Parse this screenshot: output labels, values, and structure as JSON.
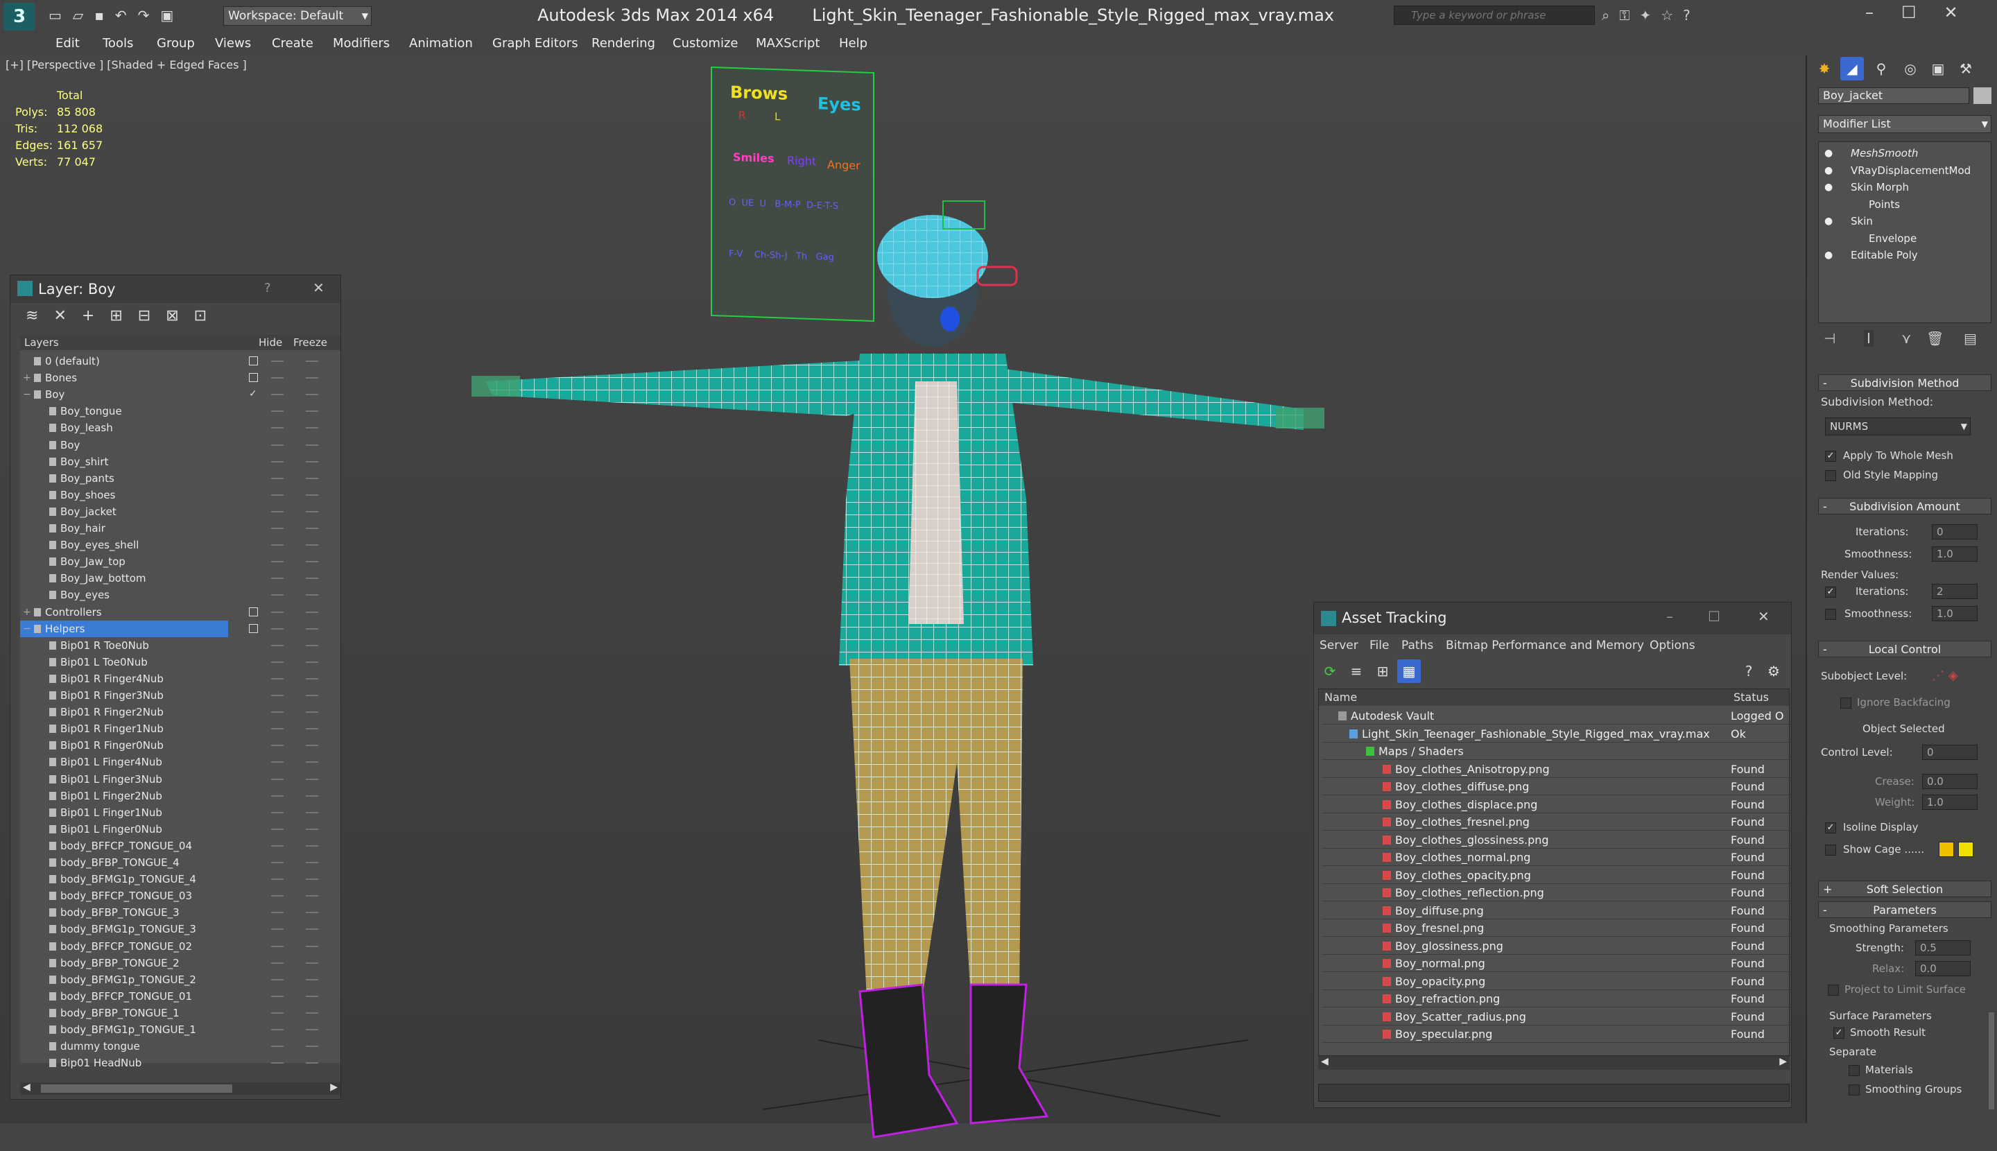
{
  "app": {
    "title": "Autodesk 3ds Max  2014 x64",
    "file": "Light_Skin_Teenager_Fashionable_Style_Rigged_max_vray.max",
    "workspace": "Workspace: Default",
    "search_placeholder": "Type a keyword or phrase"
  },
  "menu": [
    "Edit",
    "Tools",
    "Group",
    "Views",
    "Create",
    "Modifiers",
    "Animation",
    "Graph Editors",
    "Rendering",
    "Customize",
    "MAXScript",
    "Help"
  ],
  "viewport": {
    "label": "[+] [Perspective ] [Shaded + Edged Faces ]",
    "stats": {
      "total_label": "Total",
      "rows": [
        {
          "label": "Polys:",
          "value": "85 808"
        },
        {
          "label": "Tris:",
          "value": "112 068"
        },
        {
          "label": "Edges:",
          "value": "161 657"
        },
        {
          "label": "Verts:",
          "value": "77 047"
        }
      ]
    },
    "face_rig": {
      "brows": "Brows",
      "eyes": "Eyes",
      "r": "R",
      "l": "L",
      "smiles": "Smiles",
      "right": "Right",
      "anger": "Anger",
      "row2": "O  UE  U   B-M-P  D-E-T-S",
      "row3": "F-V    Ch-Sh-J   Th   Gag"
    }
  },
  "layer_panel": {
    "title": "Layer: Boy",
    "help": "?",
    "close": "✕",
    "headers": {
      "layers": "Layers",
      "hide": "Hide",
      "freeze": "Freeze"
    },
    "rows": [
      {
        "label": "0 (default)",
        "level": 0,
        "expand": "",
        "box": true
      },
      {
        "label": "Bones",
        "level": 0,
        "expand": "+",
        "box": true
      },
      {
        "label": "Boy",
        "level": 0,
        "expand": "−",
        "check": true
      },
      {
        "label": "Boy_tongue",
        "level": 1
      },
      {
        "label": "Boy_leash",
        "level": 1
      },
      {
        "label": "Boy",
        "level": 1
      },
      {
        "label": "Boy_shirt",
        "level": 1
      },
      {
        "label": "Boy_pants",
        "level": 1
      },
      {
        "label": "Boy_shoes",
        "level": 1
      },
      {
        "label": "Boy_jacket",
        "level": 1
      },
      {
        "label": "Boy_hair",
        "level": 1
      },
      {
        "label": "Boy_eyes_shell",
        "level": 1
      },
      {
        "label": "Boy_Jaw_top",
        "level": 1
      },
      {
        "label": "Boy_Jaw_bottom",
        "level": 1
      },
      {
        "label": "Boy_eyes",
        "level": 1
      },
      {
        "label": "Controllers",
        "level": 0,
        "expand": "+",
        "box": true
      },
      {
        "label": "Helpers",
        "level": 0,
        "expand": "−",
        "box": true,
        "selected": true
      },
      {
        "label": "Bip01 R Toe0Nub",
        "level": 1
      },
      {
        "label": "Bip01 L Toe0Nub",
        "level": 1
      },
      {
        "label": "Bip01 R Finger4Nub",
        "level": 1
      },
      {
        "label": "Bip01 R Finger3Nub",
        "level": 1
      },
      {
        "label": "Bip01 R Finger2Nub",
        "level": 1
      },
      {
        "label": "Bip01 R Finger1Nub",
        "level": 1
      },
      {
        "label": "Bip01 R Finger0Nub",
        "level": 1
      },
      {
        "label": "Bip01 L Finger4Nub",
        "level": 1
      },
      {
        "label": "Bip01 L Finger3Nub",
        "level": 1
      },
      {
        "label": "Bip01 L Finger2Nub",
        "level": 1
      },
      {
        "label": "Bip01 L Finger1Nub",
        "level": 1
      },
      {
        "label": "Bip01 L Finger0Nub",
        "level": 1
      },
      {
        "label": "body_BFFCP_TONGUE_04",
        "level": 1
      },
      {
        "label": "body_BFBP_TONGUE_4",
        "level": 1
      },
      {
        "label": "body_BFMG1p_TONGUE_4",
        "level": 1
      },
      {
        "label": "body_BFFCP_TONGUE_03",
        "level": 1
      },
      {
        "label": "body_BFBP_TONGUE_3",
        "level": 1
      },
      {
        "label": "body_BFMG1p_TONGUE_3",
        "level": 1
      },
      {
        "label": "body_BFFCP_TONGUE_02",
        "level": 1
      },
      {
        "label": "body_BFBP_TONGUE_2",
        "level": 1
      },
      {
        "label": "body_BFMG1p_TONGUE_2",
        "level": 1
      },
      {
        "label": "body_BFFCP_TONGUE_01",
        "level": 1
      },
      {
        "label": "body_BFBP_TONGUE_1",
        "level": 1
      },
      {
        "label": "body_BFMG1p_TONGUE_1",
        "level": 1
      },
      {
        "label": "dummy tongue",
        "level": 1
      },
      {
        "label": "Bip01 HeadNub",
        "level": 1
      }
    ]
  },
  "asset_panel": {
    "title": "Asset Tracking",
    "menu": [
      "Server",
      "File",
      "Paths",
      "Bitmap Performance and Memory",
      "Options"
    ],
    "headers": {
      "name": "Name",
      "status": "Status"
    },
    "rows": [
      {
        "name": "Autodesk Vault",
        "status": "Logged O",
        "level": 0
      },
      {
        "name": "Light_Skin_Teenager_Fashionable_Style_Rigged_max_vray.max",
        "status": "Ok",
        "level": 1
      },
      {
        "name": "Maps / Shaders",
        "status": "",
        "level": 2
      },
      {
        "name": "Boy_clothes_Anisotropy.png",
        "status": "Found",
        "level": 3
      },
      {
        "name": "Boy_clothes_diffuse.png",
        "status": "Found",
        "level": 3
      },
      {
        "name": "Boy_clothes_displace.png",
        "status": "Found",
        "level": 3
      },
      {
        "name": "Boy_clothes_fresnel.png",
        "status": "Found",
        "level": 3
      },
      {
        "name": "Boy_clothes_glossiness.png",
        "status": "Found",
        "level": 3
      },
      {
        "name": "Boy_clothes_normal.png",
        "status": "Found",
        "level": 3
      },
      {
        "name": "Boy_clothes_opacity.png",
        "status": "Found",
        "level": 3
      },
      {
        "name": "Boy_clothes_reflection.png",
        "status": "Found",
        "level": 3
      },
      {
        "name": "Boy_diffuse.png",
        "status": "Found",
        "level": 3
      },
      {
        "name": "Boy_fresnel.png",
        "status": "Found",
        "level": 3
      },
      {
        "name": "Boy_glossiness.png",
        "status": "Found",
        "level": 3
      },
      {
        "name": "Boy_normal.png",
        "status": "Found",
        "level": 3
      },
      {
        "name": "Boy_opacity.png",
        "status": "Found",
        "level": 3
      },
      {
        "name": "Boy_refraction.png",
        "status": "Found",
        "level": 3
      },
      {
        "name": "Boy_Scatter_radius.png",
        "status": "Found",
        "level": 3
      },
      {
        "name": "Boy_specular.png",
        "status": "Found",
        "level": 3
      }
    ]
  },
  "command_panel": {
    "object_name": "Boy_jacket",
    "modifier_list": "Modifier List",
    "stack": [
      {
        "label": "MeshSmooth",
        "italic": true,
        "level": 0
      },
      {
        "label": "VRayDisplacementMod",
        "level": 0
      },
      {
        "label": "Skin Morph",
        "level": 0
      },
      {
        "label": "Points",
        "level": 1
      },
      {
        "label": "Skin",
        "level": 0
      },
      {
        "label": "Envelope",
        "level": 1
      },
      {
        "label": "Editable Poly",
        "level": 0
      }
    ],
    "subdivision_method": {
      "header": "Subdivision Method",
      "label": "Subdivision Method:",
      "value": "NURMS",
      "apply_whole": "Apply To Whole Mesh",
      "old_style": "Old Style Mapping"
    },
    "subdivision_amount": {
      "header": "Subdivision Amount",
      "iterations_label": "Iterations:",
      "iterations": "0",
      "smoothness_label": "Smoothness:",
      "smoothness": "1.0",
      "render_values": "Render Values:",
      "r_iterations_label": "Iterations:",
      "r_iterations": "2",
      "r_smoothness_label": "Smoothness:",
      "r_smoothness": "1.0"
    },
    "local_control": {
      "header": "Local Control",
      "subobject": "Subobject Level:",
      "ignore_backfacing": "Ignore Backfacing",
      "object_selected": "Object Selected",
      "control_level_label": "Control Level:",
      "control_level": "0",
      "crease_label": "Crease:",
      "crease": "0.0",
      "weight_label": "Weight:",
      "weight": "1.0",
      "isoline": "Isoline Display",
      "show_cage": "Show Cage ......"
    },
    "soft_selection": "Soft Selection",
    "parameters": {
      "header": "Parameters",
      "smoothing": "Smoothing Parameters",
      "strength_label": "Strength:",
      "strength": "0.5",
      "relax_label": "Relax:",
      "relax": "0.0",
      "project": "Project to Limit Surface",
      "surface": "Surface Parameters",
      "smooth_result": "Smooth Result",
      "separate": "Separate",
      "materials": "Materials",
      "smoothing_groups": "Smoothing Groups"
    }
  },
  "colors": {
    "selection": "#3a7bd5",
    "accent_yellow": "#f0d000",
    "jacket": "#1aa89a",
    "pants": "#b49a50"
  }
}
